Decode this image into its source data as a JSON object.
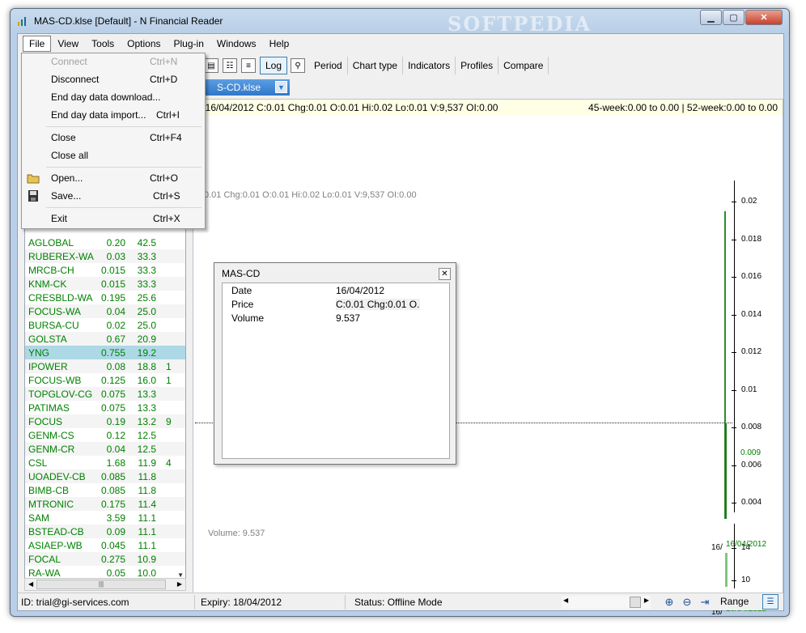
{
  "window": {
    "title": "MAS-CD.klse [Default] - N Financial Reader",
    "watermark": "SOFTPEDIA"
  },
  "menubar": [
    "File",
    "View",
    "Tools",
    "Options",
    "Plug-in",
    "Windows",
    "Help"
  ],
  "file_menu": {
    "items": [
      {
        "label": "Connect",
        "shortcut": "Ctrl+N",
        "disabled": true
      },
      {
        "label": "Disconnect",
        "shortcut": "Ctrl+D"
      },
      {
        "label": "End day data download...",
        "shortcut": ""
      },
      {
        "label": "End day data import...",
        "shortcut": "Ctrl+I"
      },
      {
        "label": "Close",
        "shortcut": "Ctrl+F4"
      },
      {
        "label": "Close all",
        "shortcut": ""
      },
      {
        "label": "Open...",
        "shortcut": "Ctrl+O",
        "icon": "folder-icon"
      },
      {
        "label": "Save...",
        "shortcut": "Ctrl+S",
        "icon": "floppy-disk-icon"
      },
      {
        "label": "Exit",
        "shortcut": "Ctrl+X"
      }
    ]
  },
  "toolbar": {
    "icons": [
      "chart-icon",
      "properties-icon",
      "list-icon"
    ],
    "log_label": "Log",
    "preview_icon": "print-preview-icon",
    "buttons": [
      "Period",
      "Chart type",
      "Indicators",
      "Profiles",
      "Compare"
    ]
  },
  "doc_tab": {
    "label": "S-CD.klse",
    "dropdown_icon": "chevron-down-icon"
  },
  "chart": {
    "info_left": "/ 16/04/2012 C:0.01 Chg:0.01 O:0.01 Hi:0.02 Lo:0.01 V:9,537 OI:0.00",
    "info_right": "45-week:0.00 to 0.00 | 52-week:0.00 to 0.00",
    "overlay": "C:0.01 Chg:0.01 O:0.01 Hi:0.02 Lo:0.01 V:9,537 OI:0.00",
    "volume_label": "Volume: 9.537",
    "price_ticks": [
      "0.02",
      "0.018",
      "0.016",
      "0.014",
      "0.012",
      "0.01",
      "0.008",
      "0.006",
      "0.004"
    ],
    "current_price": "0.009",
    "volume_ticks": [
      "14",
      "10"
    ],
    "date_prefix": "16/",
    "date": "16/04/2012",
    "colors": {
      "up": "#008000",
      "info_bg": "#ffffe6"
    }
  },
  "popup": {
    "title": "MAS-CD",
    "close_icon": "close-icon",
    "rows": [
      {
        "key": "Date",
        "value": "16/04/2012"
      },
      {
        "key": "Price",
        "value": "C:0.01 Chg:0.01 O..."
      },
      {
        "key": "Volume",
        "value": "9.537"
      }
    ]
  },
  "stocks": [
    {
      "name": "AGLOBAL",
      "price": "0.20",
      "chg": "42.5",
      "extra": ""
    },
    {
      "name": "RUBEREX-WA",
      "price": "0.03",
      "chg": "33.3",
      "extra": ""
    },
    {
      "name": "MRCB-CH",
      "price": "0.015",
      "chg": "33.3",
      "extra": ""
    },
    {
      "name": "KNM-CK",
      "price": "0.015",
      "chg": "33.3",
      "extra": ""
    },
    {
      "name": "CRESBLD-WA",
      "price": "0.195",
      "chg": "25.6",
      "extra": ""
    },
    {
      "name": "FOCUS-WA",
      "price": "0.04",
      "chg": "25.0",
      "extra": ""
    },
    {
      "name": "BURSA-CU",
      "price": "0.02",
      "chg": "25.0",
      "extra": ""
    },
    {
      "name": "GOLSTA",
      "price": "0.67",
      "chg": "20.9",
      "extra": ""
    },
    {
      "name": "YNG",
      "price": "0.755",
      "chg": "19.2",
      "extra": "",
      "selected": true
    },
    {
      "name": "IPOWER",
      "price": "0.08",
      "chg": "18.8",
      "extra": "1"
    },
    {
      "name": "FOCUS-WB",
      "price": "0.125",
      "chg": "16.0",
      "extra": "1"
    },
    {
      "name": "TOPGLOV-CG",
      "price": "0.075",
      "chg": "13.3",
      "extra": ""
    },
    {
      "name": "PATIMAS",
      "price": "0.075",
      "chg": "13.3",
      "extra": ""
    },
    {
      "name": "FOCUS",
      "price": "0.19",
      "chg": "13.2",
      "extra": "9"
    },
    {
      "name": "GENM-CS",
      "price": "0.12",
      "chg": "12.5",
      "extra": ""
    },
    {
      "name": "GENM-CR",
      "price": "0.04",
      "chg": "12.5",
      "extra": ""
    },
    {
      "name": "CSL",
      "price": "1.68",
      "chg": "11.9",
      "extra": "4"
    },
    {
      "name": "UOADEV-CB",
      "price": "0.085",
      "chg": "11.8",
      "extra": ""
    },
    {
      "name": "BIMB-CB",
      "price": "0.085",
      "chg": "11.8",
      "extra": ""
    },
    {
      "name": "MTRONIC",
      "price": "0.175",
      "chg": "11.4",
      "extra": ""
    },
    {
      "name": "SAM",
      "price": "3.59",
      "chg": "11.1",
      "extra": ""
    },
    {
      "name": "BSTEAD-CB",
      "price": "0.09",
      "chg": "11.1",
      "extra": ""
    },
    {
      "name": "ASIAEP-WB",
      "price": "0.045",
      "chg": "11.1",
      "extra": ""
    },
    {
      "name": "FOCAL",
      "price": "0.275",
      "chg": "10.9",
      "extra": ""
    },
    {
      "name": "RA-WA",
      "price": "0.05",
      "chg": "10.0",
      "extra": ""
    }
  ],
  "statusbar": {
    "id": "ID: trial@gi-services.com",
    "expiry": "Expiry: 18/04/2012",
    "status": "Status: Offline Mode",
    "range": "Range",
    "icons": [
      "zoom-in-icon",
      "zoom-out-icon",
      "go-to-end-icon",
      "panel-toggle-icon"
    ]
  }
}
